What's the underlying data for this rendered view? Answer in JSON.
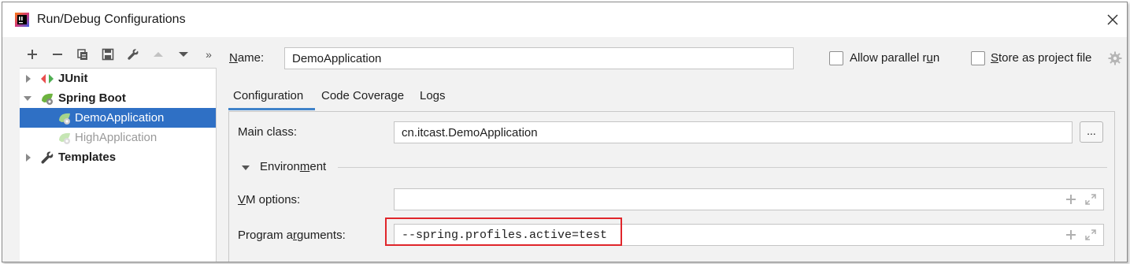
{
  "window": {
    "title": "Run/Debug Configurations"
  },
  "toolbar": {
    "buttons": [
      "add-icon",
      "remove-icon",
      "copy-icon",
      "save-icon",
      "wrench-icon",
      "move-up-icon",
      "move-down-icon",
      "more-icon"
    ],
    "more_label": "»"
  },
  "tree": {
    "items": [
      {
        "label": "JUnit",
        "expanded": false
      },
      {
        "label": "Spring Boot",
        "expanded": true
      },
      {
        "label": "DemoApplication",
        "selected": true
      },
      {
        "label": "HighApplication"
      },
      {
        "label": "Templates",
        "expanded": false
      }
    ]
  },
  "name_field": {
    "label": "Name:",
    "label_mnemonic": "N",
    "label_rest": "ame:",
    "value": "DemoApplication"
  },
  "options": {
    "allow_parallel": {
      "label_pre": "Allow parallel r",
      "label_mn": "u",
      "label_post": "n",
      "checked": false
    },
    "store_as_file": {
      "label_pre": "",
      "label_mn": "S",
      "label_post": "tore as project file",
      "checked": false
    }
  },
  "tabs": [
    {
      "label": "Configuration",
      "active": true
    },
    {
      "label": "Code Coverage",
      "active": false
    },
    {
      "label": "Logs",
      "active": false
    }
  ],
  "config": {
    "main_class_label": "Main class:",
    "main_class_value": "cn.itcast.DemoApplication",
    "browse_label": "...",
    "environment_pre": "Environ",
    "environment_mn": "m",
    "environment_post": "ent",
    "vm_options_mn": "V",
    "vm_options_rest": "M options:",
    "vm_options_value": "",
    "program_args_pre": "Program a",
    "program_args_mn": "r",
    "program_args_post": "guments:",
    "program_args_value": "--spring.profiles.active=test"
  },
  "colors": {
    "selection": "#2f70c5",
    "highlight_box": "#e0262b",
    "tab_underline": "#4083c9"
  }
}
